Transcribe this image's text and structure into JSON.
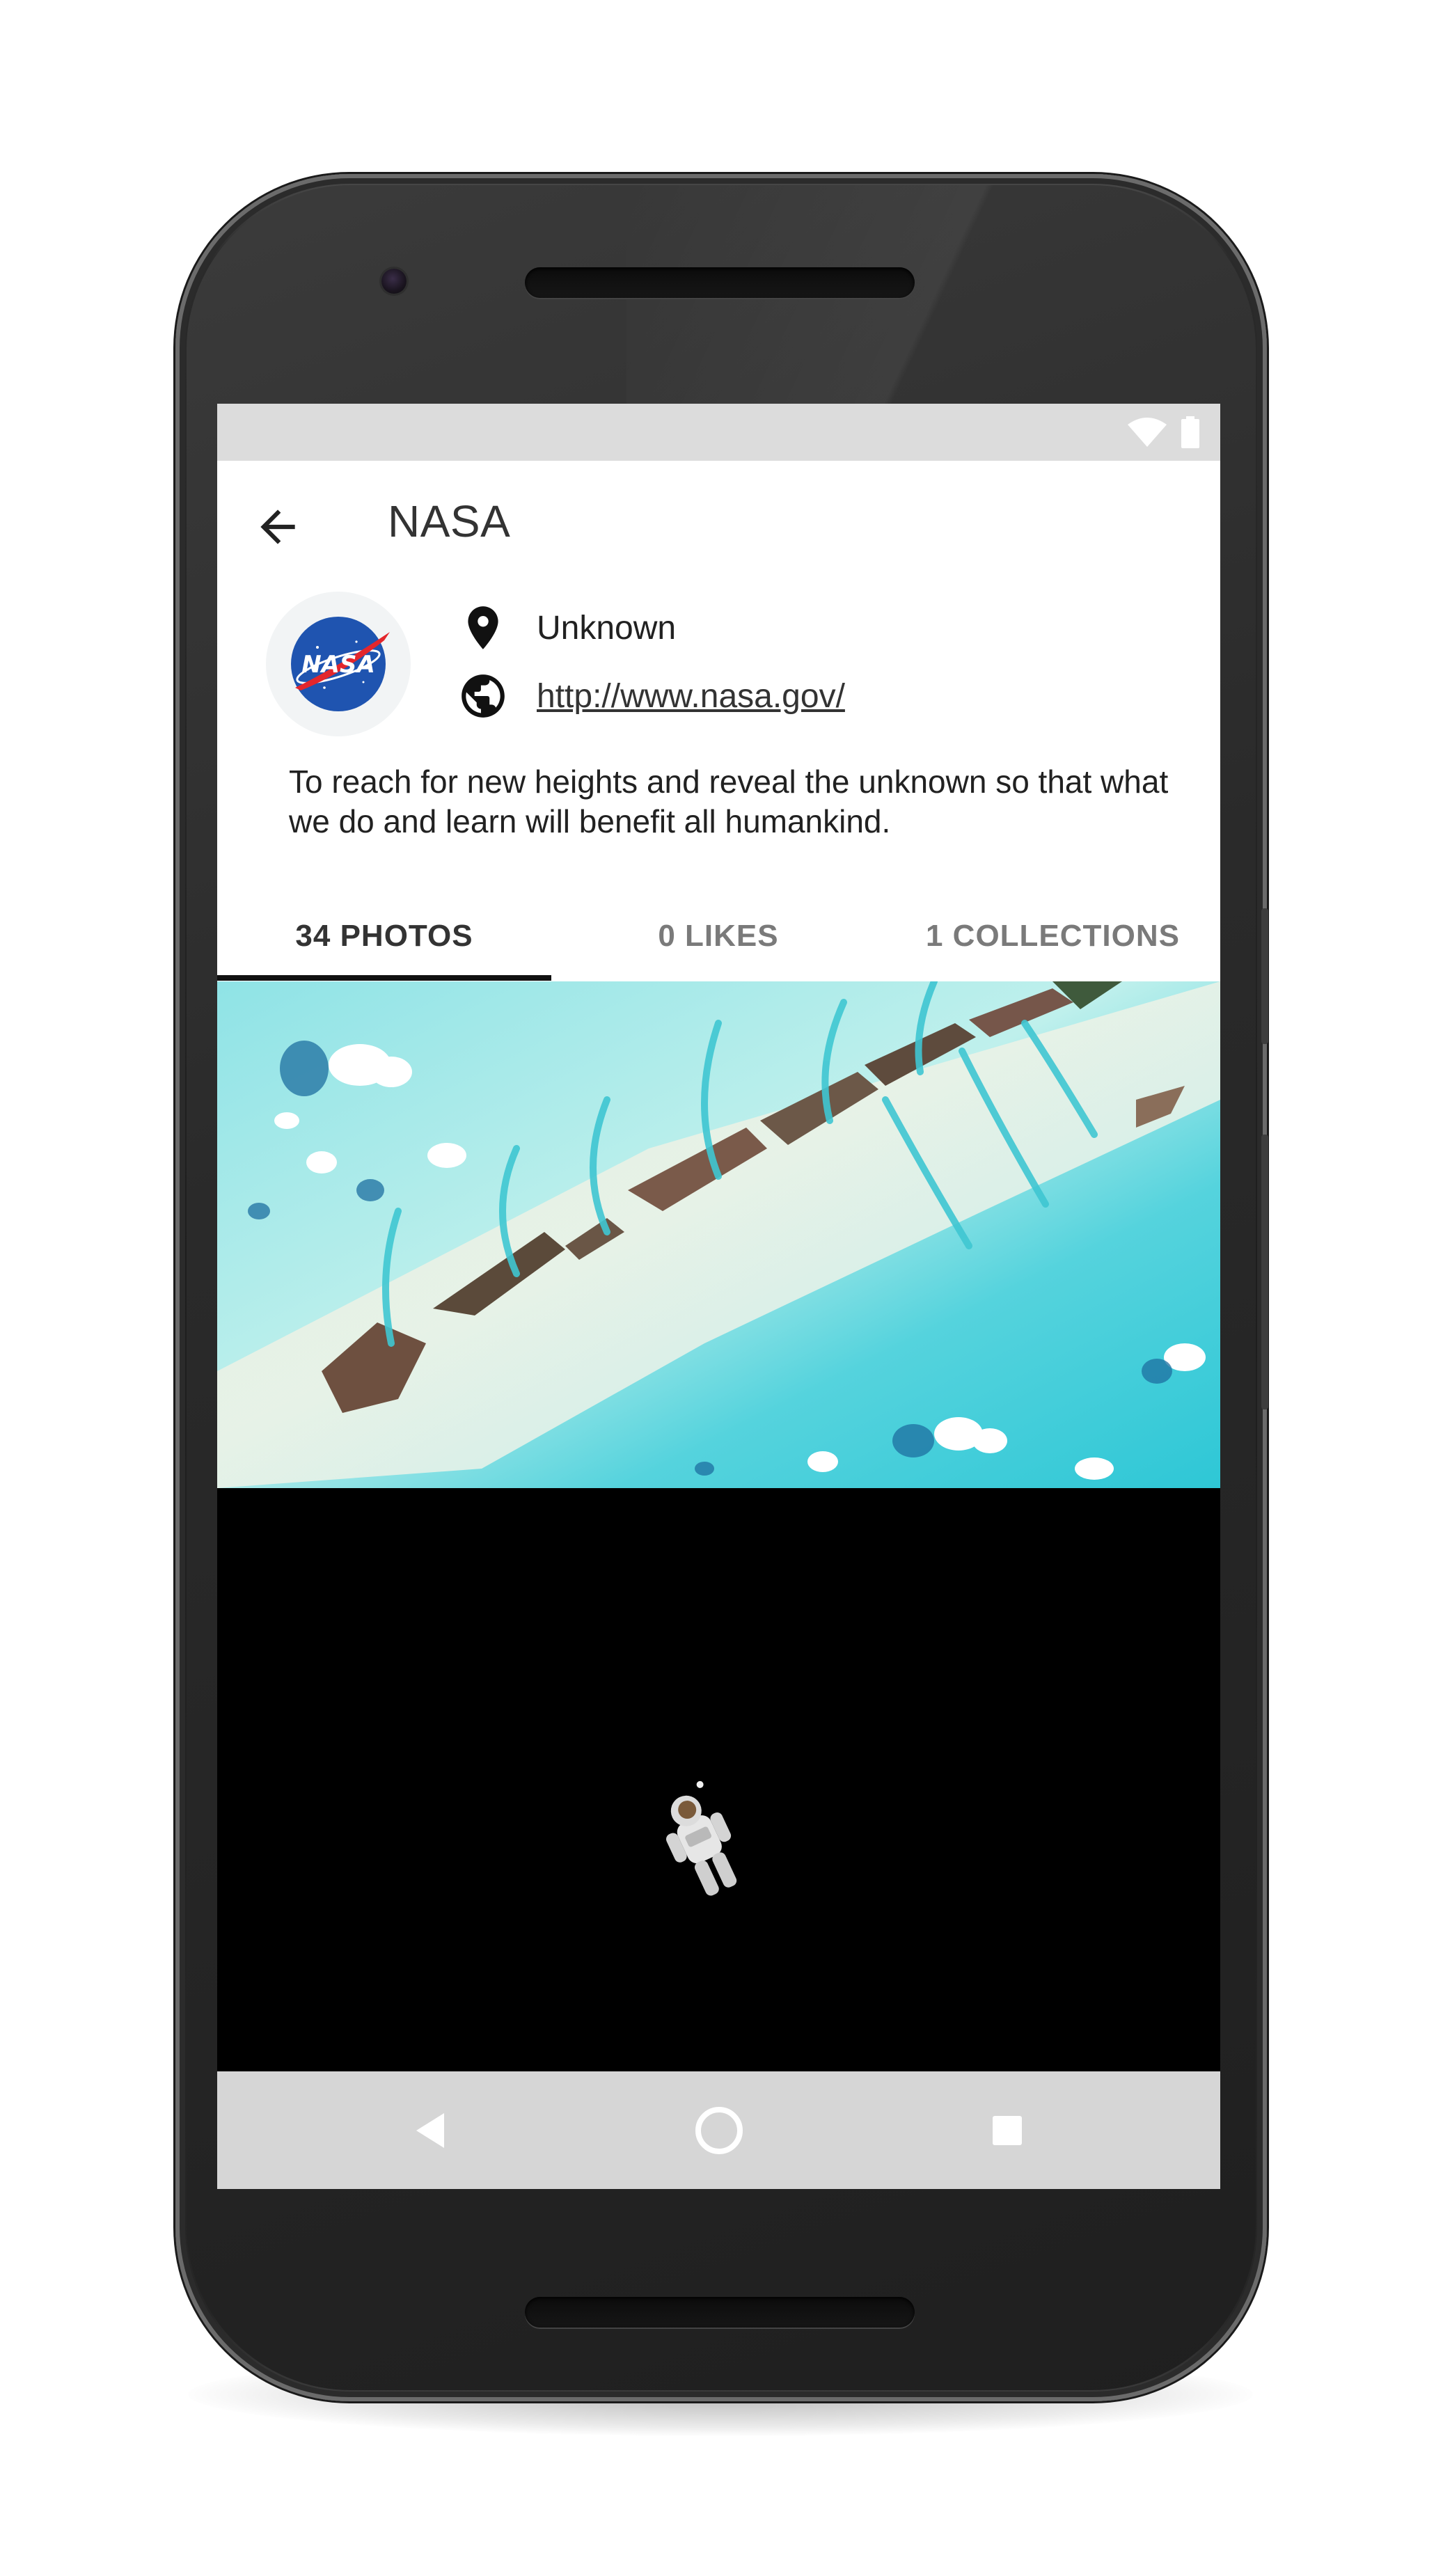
{
  "app": {
    "title": "NASA"
  },
  "status_bar": {
    "icons": [
      "wifi-icon",
      "battery-icon"
    ]
  },
  "profile": {
    "avatar_logo_text": "NASA",
    "location": "Unknown",
    "website": "http://www.nasa.gov/",
    "bio": "To reach for new heights and reveal the unknown so that what we do and learn will benefit all humankind."
  },
  "tabs": [
    {
      "label": "34 PHOTOS",
      "selected": true
    },
    {
      "label": "0 LIKES",
      "selected": false
    },
    {
      "label": "1 COLLECTIONS",
      "selected": false
    }
  ],
  "photos": [
    {
      "subject": "aerial-islands-turquoise-sea"
    },
    {
      "subject": "astronaut-in-space"
    }
  ],
  "nav_bar": {
    "icons": [
      "nav-back-icon",
      "nav-home-icon",
      "nav-recents-icon"
    ]
  },
  "colors": {
    "status_bar": "#dcdcdc",
    "nav_bar": "#d6d6d6",
    "tab_active": "#333333",
    "tab_inactive": "#7a7a7a",
    "tab_indicator": "#111111"
  }
}
